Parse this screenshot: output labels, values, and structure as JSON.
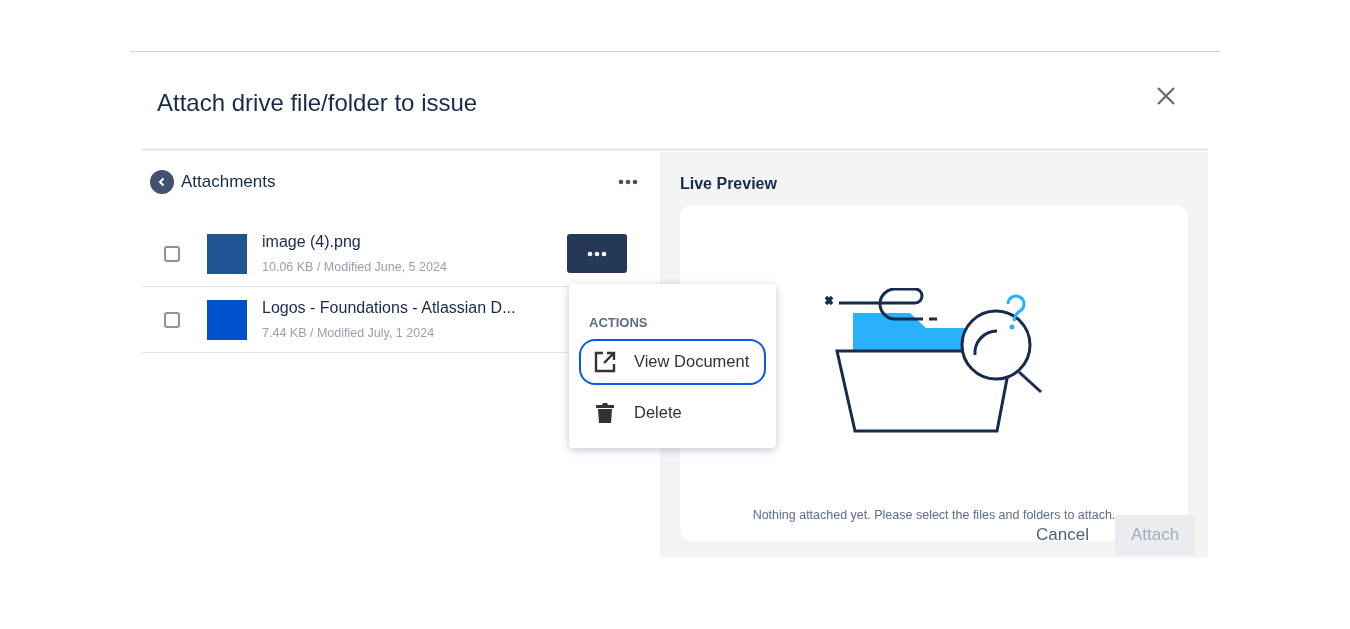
{
  "dialog": {
    "title": "Attach drive file/folder to issue"
  },
  "browser": {
    "title": "Attachments",
    "files": [
      {
        "name": "image (4).png",
        "meta": "10.06 KB / Modified June, 5 2024",
        "checked": false,
        "color": "#1f5393"
      },
      {
        "name": "Logos - Foundations - Atlassian D...",
        "meta": "7.44 KB / Modified July, 1 2024",
        "checked": false,
        "color": "#0052cc"
      }
    ],
    "menu": {
      "heading": "ACTIONS",
      "items": [
        {
          "label": "View Document",
          "kind": "open",
          "selected": true
        },
        {
          "label": "Delete",
          "kind": "delete",
          "selected": false
        }
      ]
    }
  },
  "preview": {
    "title": "Live Preview",
    "message": "Nothing attached yet. Please select the files and folders to attach."
  },
  "buttons": [
    {
      "label": "Cancel",
      "disabled": false
    },
    {
      "label": "Attach",
      "disabled": true
    }
  ]
}
